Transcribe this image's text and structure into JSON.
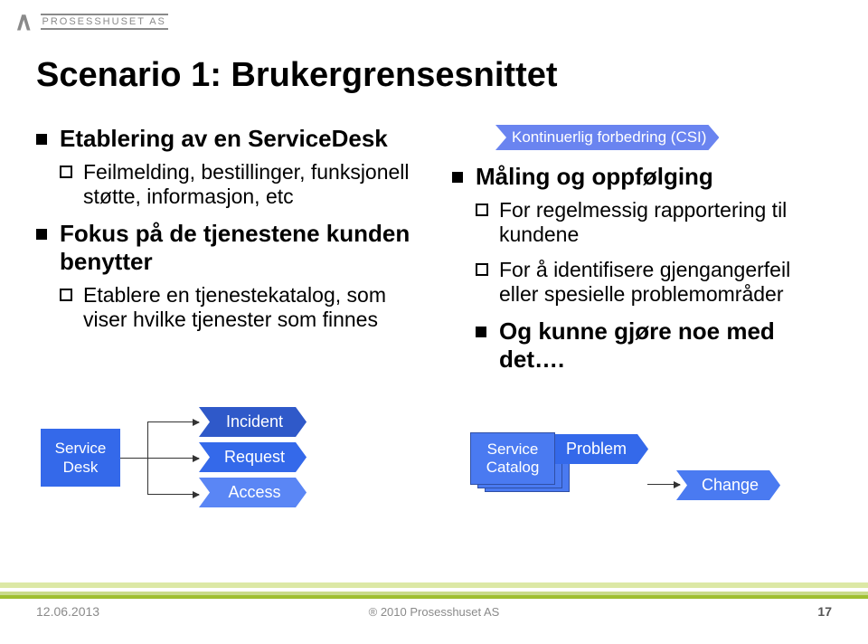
{
  "brand": {
    "logo_label": "PROSESSHUSET AS"
  },
  "title": "Scenario 1: Brukergrensesnittet",
  "left": {
    "item1": {
      "heading": "Etablering av en ServiceDesk",
      "sub1": "Feilmelding, bestillinger, funksjonell støtte, informasjon, etc"
    },
    "item2": {
      "heading": "Fokus på de tjenestene kunden benytter",
      "sub1": "Etablere en tjenestekatalog, som viser hvilke tjenester som finnes"
    }
  },
  "right": {
    "csi_label": "Kontinuerlig forbedring (CSI)",
    "item1": {
      "heading": "Måling og oppfølging",
      "sub1": "For regelmessig rapportering til kundene",
      "sub2": "For å identifisere gjengangerfeil eller spesielle problemområder"
    },
    "item2": {
      "heading": "Og kunne gjøre noe med det…."
    }
  },
  "diagram": {
    "service_desk": "Service\nDesk",
    "incident": "Incident",
    "request": "Request",
    "access": "Access",
    "service_catalog": "Service\nCatalog",
    "problem": "Problem",
    "change": "Change"
  },
  "footer": {
    "date": "12.06.2013",
    "copyright": "® 2010 Prosesshuset AS",
    "page": "17"
  }
}
